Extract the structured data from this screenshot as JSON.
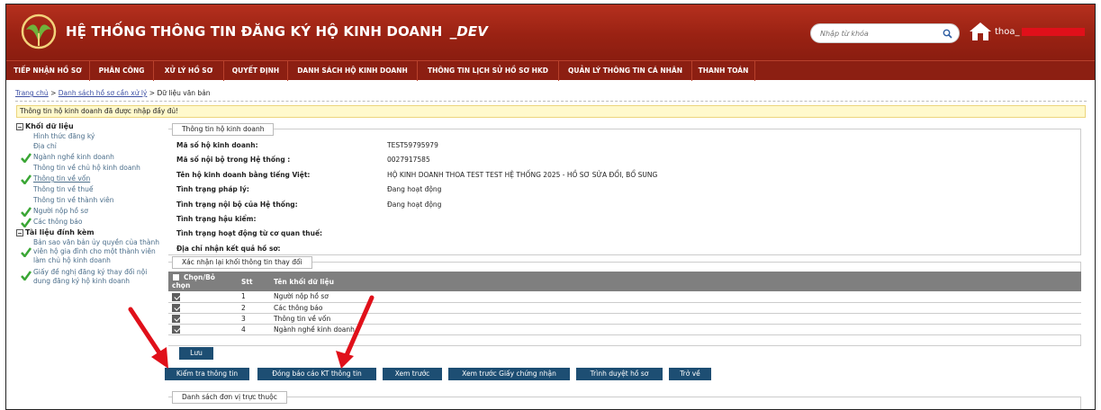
{
  "header": {
    "title": "HỆ THỐNG THÔNG TIN ĐĂNG KÝ HỘ KINH DOANH",
    "env": "_DEV",
    "search_placeholder": "Nhập từ khóa",
    "user_name": "thoa_"
  },
  "menu": [
    "TIẾP NHẬN HỒ SƠ",
    "PHÂN CÔNG",
    "XỬ LÝ HỒ SƠ",
    "QUYẾT ĐỊNH",
    "DANH SÁCH HỘ KINH DOANH",
    "THÔNG TIN LỊCH SỬ HỒ SƠ HKD",
    "QUẢN LÝ THÔNG TIN CÁ NHÂN",
    "THANH TOÁN"
  ],
  "breadcrumb": {
    "home": "Trang chủ",
    "sep": ">",
    "list": "Danh sách hồ sơ cần xử lý",
    "current": "Dữ liệu văn bản"
  },
  "notice": "Thông tin hộ kinh doanh đã được nhập đầy đủ!",
  "sidebar": {
    "group1": "Khối dữ liệu",
    "items1": [
      {
        "label": "Hình thức đăng ký",
        "check": false,
        "underline": false
      },
      {
        "label": "Địa chỉ",
        "check": false,
        "underline": false
      },
      {
        "label": "Ngành nghề kinh doanh",
        "check": true,
        "underline": false
      },
      {
        "label": "Thông tin về chủ hộ kinh doanh",
        "check": false,
        "underline": false
      },
      {
        "label": "Thông tin về vốn",
        "check": true,
        "underline": true
      },
      {
        "label": "Thông tin về thuế",
        "check": false,
        "underline": false
      },
      {
        "label": "Thông tin về thành viên",
        "check": false,
        "underline": false
      },
      {
        "label": "Người nộp hồ sơ",
        "check": true,
        "underline": false
      },
      {
        "label": "Các thông báo",
        "check": true,
        "underline": false
      }
    ],
    "group2": "Tài liệu đính kèm",
    "items2": [
      {
        "label": "Bản sao văn bản ủy quyền của thành viên hộ gia đình cho một thành viên làm chủ hộ kinh doanh",
        "check": true
      },
      {
        "label": "Giấy đề nghị đăng ký thay đổi nội dung đăng ký hộ kinh doanh",
        "check": true
      }
    ]
  },
  "info": {
    "tab": "Thông tin hộ kinh doanh",
    "rows": [
      {
        "label": "Mã số hộ kinh doanh:",
        "value": "TEST59795979"
      },
      {
        "label": "Mã số nội bộ trong Hệ thống :",
        "value": "0027917585"
      },
      {
        "label": "Tên hộ kinh doanh bằng tiếng Việt:",
        "value": "HỘ KINH DOANH THOA TEST TEST HỆ THỐNG 2025 - HỒ SƠ SỬA ĐỔI, BỔ SUNG"
      },
      {
        "label": "Tình trạng pháp lý:",
        "value": "Đang hoạt động"
      },
      {
        "label": "Tình trạng nội bộ của Hệ thống:",
        "value": "Đang hoạt động"
      },
      {
        "label": "Tình trạng hậu kiểm:",
        "value": ""
      },
      {
        "label": "Tình trạng hoạt động từ cơ quan thuế:",
        "value": ""
      },
      {
        "label": "Địa chỉ nhận kết quả hồ sơ:",
        "value": ""
      }
    ]
  },
  "confirm": {
    "tab": "Xác nhận lại khối thông tin thay đổi",
    "headers": [
      "Chọn/Bỏ chọn",
      "Stt",
      "Tên khối dữ liệu"
    ],
    "rows": [
      {
        "checked": true,
        "stt": "1",
        "name": "Người nộp hồ sơ"
      },
      {
        "checked": true,
        "stt": "2",
        "name": "Các thông báo"
      },
      {
        "checked": true,
        "stt": "3",
        "name": "Thông tin về vốn"
      },
      {
        "checked": true,
        "stt": "4",
        "name": "Ngành nghề kinh doanh"
      }
    ],
    "save": "Lưu"
  },
  "actions": [
    "Kiểm tra thông tin",
    "Đóng báo cáo KT thông tin",
    "Xem trước",
    "Xem trước Giấy chứng nhận",
    "Trình duyệt hồ sơ",
    "Trở về"
  ],
  "units_tab": "Danh sách đơn vị trực thuộc",
  "colors": {
    "header": "#9a2213",
    "menubar": "#8c1f12",
    "button": "#1d4e73",
    "arrow": "#e0101a",
    "check": "#3aa635"
  }
}
